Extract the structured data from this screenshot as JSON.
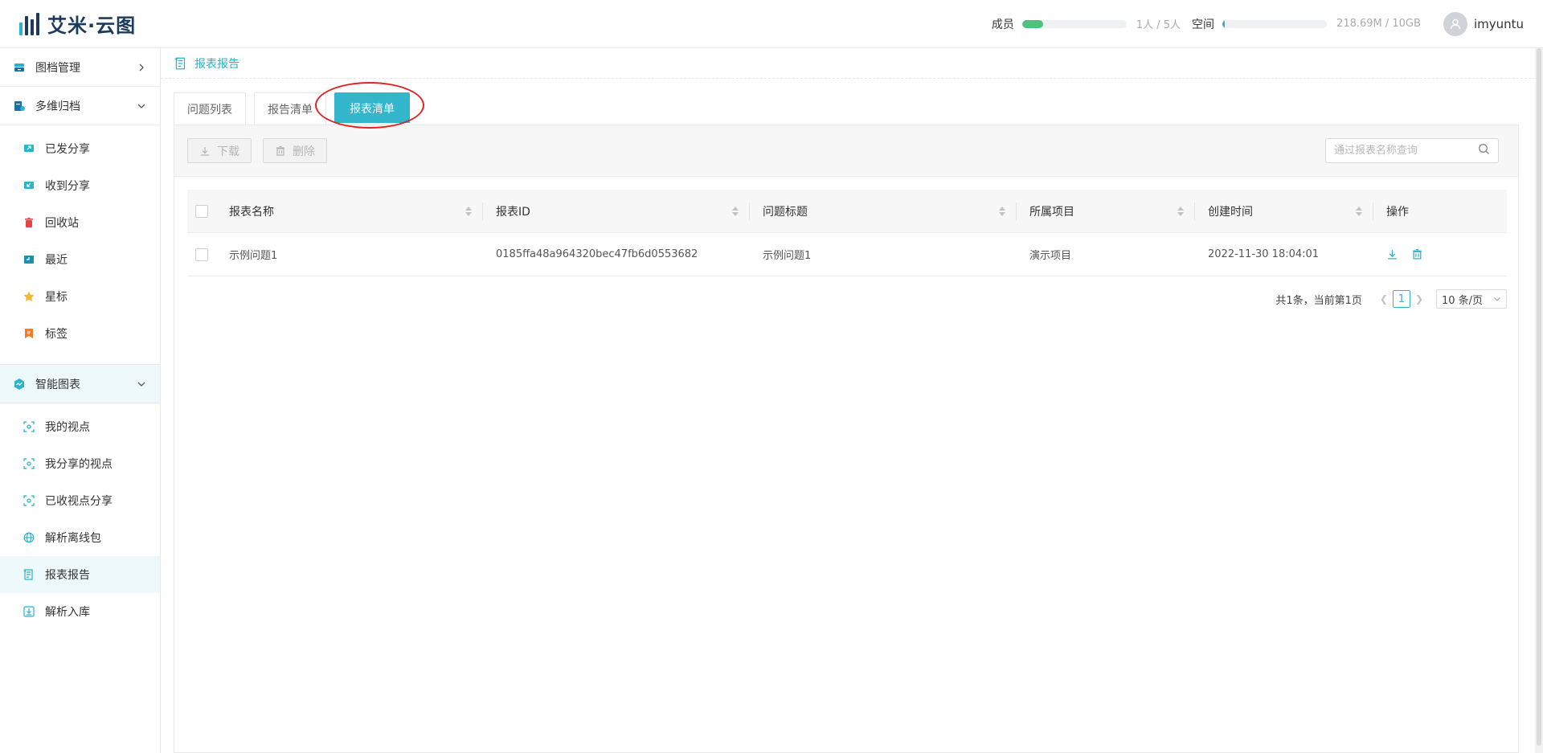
{
  "header": {
    "logo_text": "艾米·云图",
    "members_label": "成员",
    "members_value": "1人 / 5人",
    "members_fill": 0.2,
    "space_label": "空间",
    "space_value": "218.69M / 10GB",
    "space_fill": 0.02,
    "username": "imyuntu",
    "colors": {
      "members_bar": "#4fc37d",
      "space_bar": "#2bb3c9"
    }
  },
  "sidebar": {
    "groups": [
      {
        "label": "图档管理",
        "icon": "archive-icon",
        "expanded": false
      },
      {
        "label": "多维归档",
        "icon": "multi-archive-icon",
        "expanded": true,
        "items": [
          {
            "label": "已发分享",
            "icon": "share-out-icon"
          },
          {
            "label": "收到分享",
            "icon": "share-in-icon"
          },
          {
            "label": "回收站",
            "icon": "trash-icon"
          },
          {
            "label": "最近",
            "icon": "recent-icon"
          },
          {
            "label": "星标",
            "icon": "star-icon"
          },
          {
            "label": "标签",
            "icon": "tag-icon"
          }
        ]
      },
      {
        "label": "智能图表",
        "icon": "smart-chart-icon",
        "expanded": true,
        "items": [
          {
            "label": "我的视点",
            "icon": "viewpoint-icon"
          },
          {
            "label": "我分享的视点",
            "icon": "viewpoint-icon"
          },
          {
            "label": "已收视点分享",
            "icon": "viewpoint-icon"
          },
          {
            "label": "解析离线包",
            "icon": "globe-icon"
          },
          {
            "label": "报表报告",
            "icon": "report-icon",
            "active": true
          },
          {
            "label": "解析入库",
            "icon": "import-icon"
          }
        ]
      }
    ]
  },
  "breadcrumb": {
    "text": "报表报告"
  },
  "tabs": [
    {
      "label": "问题列表",
      "active": false
    },
    {
      "label": "报告清单",
      "active": false
    },
    {
      "label": "报表清单",
      "active": true
    }
  ],
  "toolbar": {
    "download_label": "下载",
    "delete_label": "删除",
    "search_placeholder": "通过报表名称查询"
  },
  "table": {
    "columns": [
      "报表名称",
      "报表ID",
      "问题标题",
      "所属项目",
      "创建时间",
      "操作"
    ],
    "rows": [
      {
        "name": "示例问题1",
        "id": "0185ffa48a964320bec47fb6d0553682",
        "title": "示例问题1",
        "project": "演示项目",
        "created": "2022-11-30 18:04:01"
      }
    ]
  },
  "pagination": {
    "summary": "共1条，当前第1页",
    "current_page": "1",
    "page_size": "10 条/页"
  },
  "accent_color": "#33b5cc"
}
